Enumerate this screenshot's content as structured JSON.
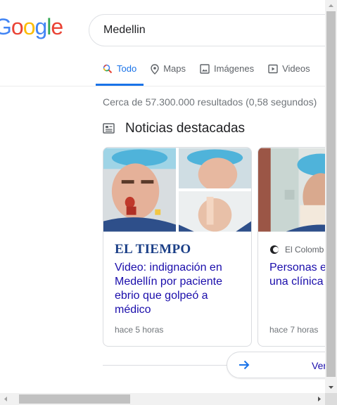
{
  "logo": {
    "letters": [
      "o",
      "o",
      "g",
      "l",
      "e"
    ],
    "partial": "G",
    "colors": [
      "#4285f4",
      "#ea4335",
      "#fbbc05",
      "#4285f4",
      "#34a853",
      "#ea4335"
    ]
  },
  "search": {
    "value": "Medellin"
  },
  "tabs": [
    {
      "label": "Todo",
      "icon": "search-icon",
      "active": true
    },
    {
      "label": "Maps",
      "icon": "map-pin-icon",
      "active": false
    },
    {
      "label": "Imágenes",
      "icon": "image-icon",
      "active": false
    },
    {
      "label": "Videos",
      "icon": "video-icon",
      "active": false
    }
  ],
  "results_stats": "Cerca de 57.300.000 resultados (0,58 segundos)",
  "top_stories": {
    "heading": "Noticias destacadas",
    "cards": [
      {
        "publisher": "EL TIEMPO",
        "title": "Video: indignación en Medellín por paciente ebrio que golpeó a médico",
        "time": "hace 5 horas"
      },
      {
        "publisher": "El Colomb",
        "title": "Personas e a golpes a una clínica",
        "time": "hace 7 horas"
      }
    ],
    "more_label": "Ver"
  },
  "accent_color": "#1a73e8",
  "link_color": "#1a0dab"
}
